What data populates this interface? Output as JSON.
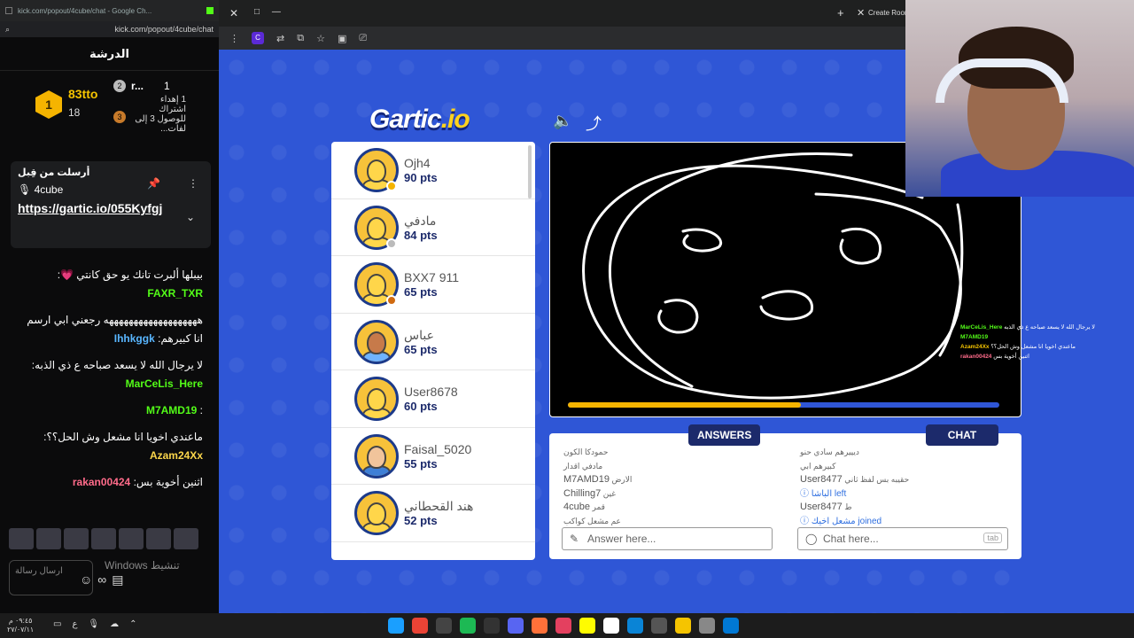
{
  "kick": {
    "url_title": "kick.com/popout/4cube/chat - Google Ch...",
    "address": "kick.com/popout/4cube/chat",
    "header": "الدرشة",
    "leaderboard": {
      "first_name": "83tto",
      "first_count": "18",
      "second_rank": "2",
      "second_name": "r...",
      "second_count": "1",
      "third_rank": "3",
      "sub_text": "1 إهداء اشتراك للوصول 3 إلى لفات..."
    },
    "pinned": {
      "title": "أرسلت من قِبل",
      "user": "4cube",
      "link": "https://gartic.io/055Kyfgj"
    },
    "messages": [
      {
        "user": "FAXR_TXR",
        "text": "بيبلها ألبرت تانك يو حق كانتي 💗",
        "color": "green"
      },
      {
        "user": "Ihhkggk",
        "text": "هههههههههههههههههههه رجعني ابي ارسم انا كبيرهم",
        "color": "blue"
      },
      {
        "user": "MarCeLis_Here",
        "text": "لا يرجال الله لا يسعد صباحه ع ذي الذبه",
        "color": "green"
      },
      {
        "user": "M7AMD19",
        "text": "",
        "color": "green"
      },
      {
        "user": "Azam24Xx",
        "text": "ماعندي اخويا انا مشعل وش الحل؟؟",
        "color": "yellow"
      },
      {
        "user": "rakan00424",
        "text": "اثنين أخوية بس",
        "color": "pink"
      }
    ],
    "input_placeholder": "ارسال رسالة",
    "windows_activate": "Windows تنشيط"
  },
  "browser": {
    "tab_title": "Create Room"
  },
  "gartic": {
    "logo_main": "Gartic",
    "logo_io": ".io",
    "players": [
      {
        "name": "Ojh4",
        "pts": "90 pts",
        "avatar": "yellow",
        "status": "#f5b400"
      },
      {
        "name": "مادفي",
        "pts": "84 pts",
        "avatar": "yellow",
        "status": "#bbbbbb"
      },
      {
        "name": "BXX7 911",
        "pts": "65 pts",
        "avatar": "yellow",
        "status": "#d06a10"
      },
      {
        "name": "عباس",
        "pts": "65 pts",
        "avatar": "brown",
        "status": ""
      },
      {
        "name": "User8678",
        "pts": "60 pts",
        "avatar": "yellow",
        "status": ""
      },
      {
        "name": "Faisal_5020",
        "pts": "55 pts",
        "avatar": "beard",
        "status": ""
      },
      {
        "name": "هند القحطاني",
        "pts": "52 pts",
        "avatar": "yellow",
        "status": ""
      }
    ],
    "timer_progress": 0.54,
    "answers_tab": "ANSWERS",
    "chat_tab": "CHAT",
    "answers": [
      {
        "user": "",
        "text": "حمودكا الكون"
      },
      {
        "user": "",
        "text": "مادفي اقدار"
      },
      {
        "user": "M7AMD19",
        "text": "الارض"
      },
      {
        "user": "Chilling7",
        "text": "غين"
      },
      {
        "user": "4cube",
        "text": "قمر"
      },
      {
        "user": "",
        "text": "عم مشعل كواكب"
      }
    ],
    "chat": [
      {
        "user": "",
        "text": "ديييرهم سادي حنو",
        "sys": false
      },
      {
        "user": "",
        "text": "كبيرهم ابي",
        "sys": false
      },
      {
        "user": "User8477",
        "text": "حقيبه بس لفظ ثاني",
        "sys": false
      },
      {
        "user": "",
        "text": "ⓘ الباشا left",
        "sys": true
      },
      {
        "user": "User8477",
        "text": "ط",
        "sys": false
      },
      {
        "user": "",
        "text": "ⓘ مشعل اخيك joined",
        "sys": true
      }
    ],
    "answer_placeholder": "Answer here...",
    "chat_placeholder": "Chat here...",
    "tab_key": "tab"
  },
  "overlay_chat": [
    {
      "user": "MarCeLis_Here",
      "text": "لا يرجال الله لا يسعد صباحه ع ذي الذبه",
      "cls": "g"
    },
    {
      "user": "M7AMD19",
      "text": "",
      "cls": "g"
    },
    {
      "user": "Azam24Xx",
      "text": "ماعندي اخويا انا مشعل وش الحل؟؟",
      "cls": "y"
    },
    {
      "user": "rakan00424",
      "text": "اثنين أخوية بس",
      "cls": "p"
    }
  ],
  "taskbar": {
    "time": "٠٩:٤٥ م",
    "date": "٢٧/٠٧/١١"
  },
  "colors": {
    "gartic_blue": "#2f56d6",
    "kick_green": "#53fc18",
    "navy": "#1c2a6b"
  }
}
